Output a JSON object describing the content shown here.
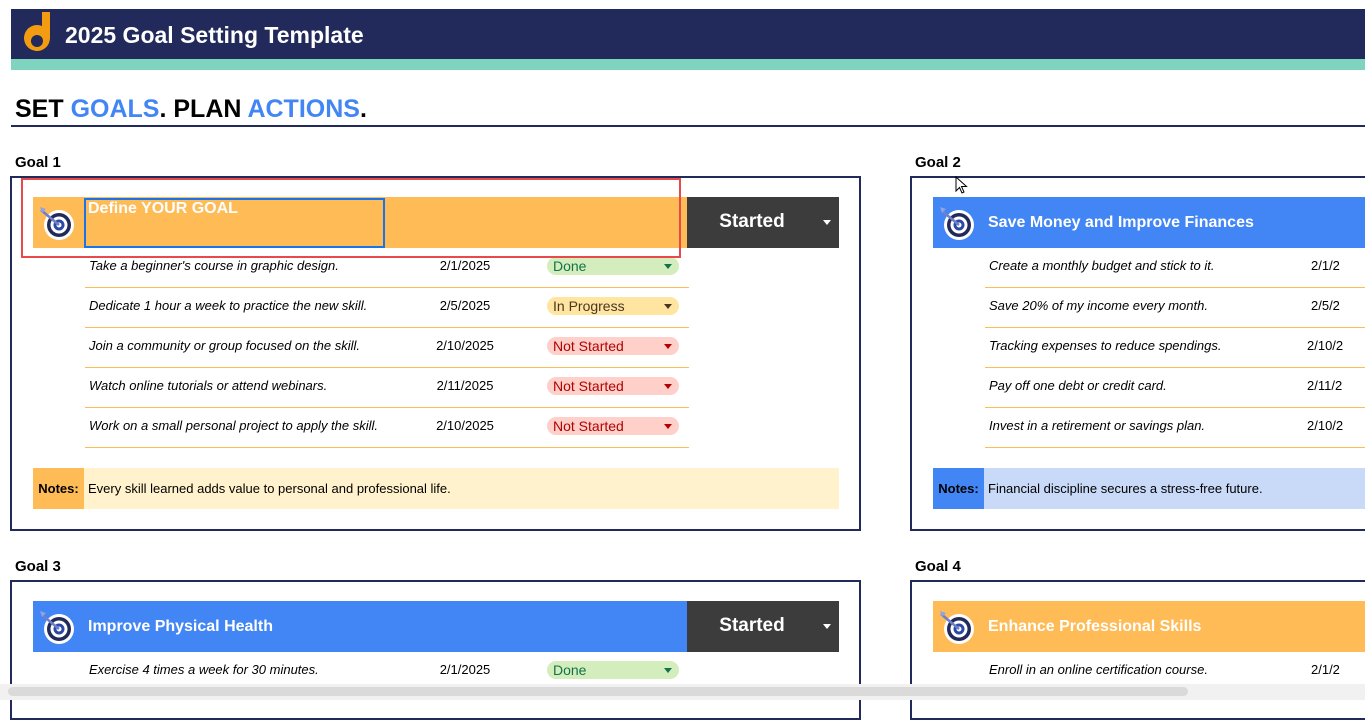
{
  "app": {
    "title": "2025 Goal Setting Template"
  },
  "tagline": {
    "part1": "SET ",
    "goals": "GOALS",
    "part2": ". PLAN ",
    "actions": "ACTIONS",
    "part3": "."
  },
  "colors": {
    "navy": "#212a5a",
    "mint": "#7ed4be",
    "orange": "#ffbb56",
    "blue": "#4285f4",
    "dark": "#3c3c3c"
  },
  "goals": [
    {
      "label": "Goal 1",
      "title": "Define YOUR GOAL",
      "status": "Started",
      "theme": "orange",
      "tasks": [
        {
          "task": "Take a beginner's course in graphic design.",
          "date": "2/1/2025",
          "state": "Done"
        },
        {
          "task": "Dedicate 1 hour a week to practice the new skill.",
          "date": "2/5/2025",
          "state": "In Progress"
        },
        {
          "task": "Join a community or group focused on the skill.",
          "date": "2/10/2025",
          "state": "Not Started"
        },
        {
          "task": "Watch online tutorials or attend webinars.",
          "date": "2/11/2025",
          "state": "Not Started"
        },
        {
          "task": "Work on a small personal project to apply the skill.",
          "date": "2/10/2025",
          "state": "Not Started"
        }
      ],
      "notes_label": "Notes:",
      "notes": "Every skill learned adds value to personal and professional life."
    },
    {
      "label": "Goal 2",
      "title": "Save Money and Improve Finances",
      "theme": "blue",
      "tasks": [
        {
          "task": "Create a monthly budget and stick to it.",
          "date": "2/1/2"
        },
        {
          "task": "Save 20% of my income every month.",
          "date": "2/5/2"
        },
        {
          "task": "Tracking expenses to reduce spendings.",
          "date": "2/10/2"
        },
        {
          "task": "Pay off one debt or credit card.",
          "date": "2/11/2"
        },
        {
          "task": "Invest in a retirement or savings plan.",
          "date": "2/10/2"
        }
      ],
      "notes_label": "Notes:",
      "notes": "Financial discipline secures a stress-free future."
    },
    {
      "label": "Goal 3",
      "title": "Improve Physical Health",
      "status": "Started",
      "theme": "blue",
      "tasks": [
        {
          "task": "Exercise 4 times a week for 30 minutes.",
          "date": "2/1/2025",
          "state": "Done"
        }
      ]
    },
    {
      "label": "Goal 4",
      "title": "Enhance Professional Skills",
      "theme": "orange",
      "tasks": [
        {
          "task": "Enroll in an online certification course.",
          "date": "2/1/2"
        }
      ]
    }
  ]
}
